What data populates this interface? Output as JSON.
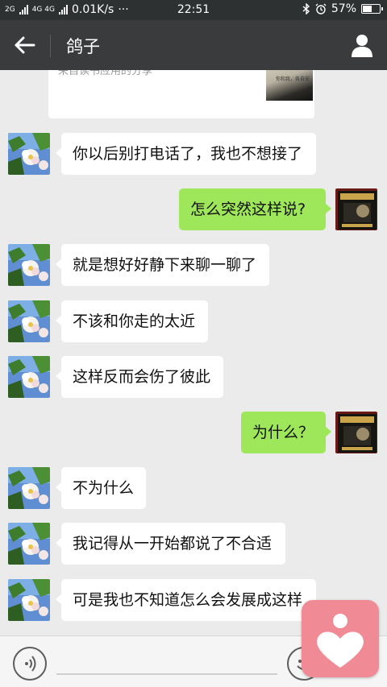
{
  "status_bar": {
    "sim1": "2G",
    "sim2": "4G 4G",
    "speed": "0.01K/s",
    "more": "···",
    "time": "22:51",
    "battery": "57%",
    "battery_level": 0.57
  },
  "header": {
    "title": "鸽子"
  },
  "share_card": {
    "text_fragment": "来自读书应用的分享",
    "thumb_caption": "你和我，各自安"
  },
  "messages": [
    {
      "side": "in",
      "text": "你以后别打电话了，我也不想接了"
    },
    {
      "side": "out",
      "text": "怎么突然这样说?"
    },
    {
      "side": "in",
      "text": "就是想好好静下来聊一聊了"
    },
    {
      "side": "in",
      "text": "不该和你走的太近"
    },
    {
      "side": "in",
      "text": "这样反而会伤了彼此"
    },
    {
      "side": "out",
      "text": "为什么？"
    },
    {
      "side": "in",
      "text": "不为什么"
    },
    {
      "side": "in",
      "text": "我记得从一开始都说了不合适"
    },
    {
      "side": "in",
      "text": "可是我也不知道怎么会发展成这样"
    }
  ],
  "icons": {
    "back": "arrow-left-icon",
    "profile": "person-icon",
    "voice": "voice-wave-icon",
    "emoji": "smiley-icon",
    "float": "heart-person-icon"
  },
  "colors": {
    "outgoing_bubble": "#9fe75a",
    "incoming_bubble": "#ffffff",
    "header": "#393b3d",
    "float_button": "#f08a94"
  }
}
